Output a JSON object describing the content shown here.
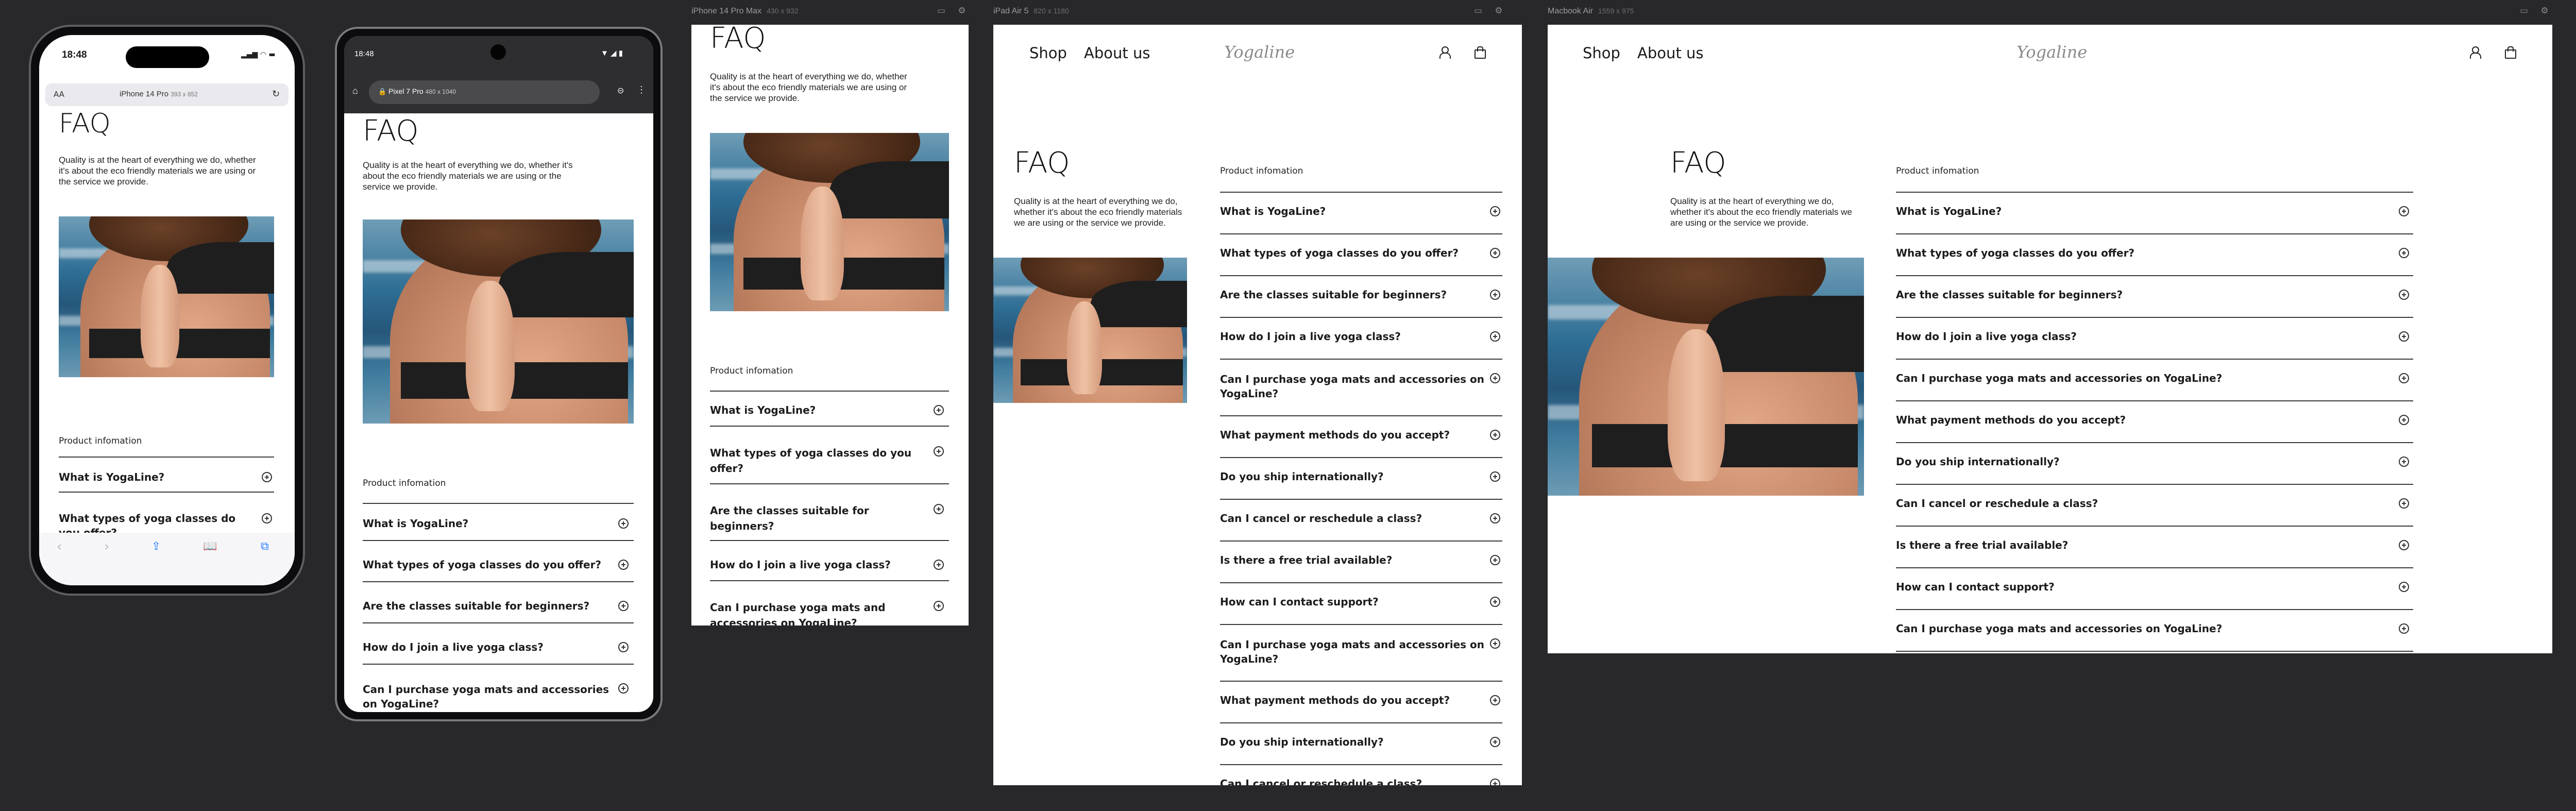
{
  "devices": {
    "iphone14pro": {
      "label": "iPhone 14 Pro",
      "dims": "393 x 852",
      "time": "18:48",
      "aa": "AA"
    },
    "pixel7": {
      "label": "Pixel 7 Pro",
      "dims": "480 x 1040",
      "time": "18:48"
    },
    "iphone14promax": {
      "label": "iPhone 14 Pro Max",
      "dims": "430 x 932"
    },
    "ipadair": {
      "label": "iPad Air 5",
      "dims": "820 x 1180"
    },
    "macbook": {
      "label": "Macbook Air",
      "dims": "1559 x 975"
    }
  },
  "page": {
    "title": "FAQ",
    "intro": "Quality is at the heart of everything we do, whether it's about the eco friendly materials we are using or the service we provide.",
    "section_heading": "Product infomation",
    "nav": {
      "shop": "Shop",
      "about": "About us",
      "logo": "Yogaline"
    }
  },
  "questions": {
    "q1": "What is YogaLine?",
    "q2": "What types of yoga classes do you offer?",
    "q3": "Are the classes suitable for beginners?",
    "q4": "How do I join a live yoga class?",
    "q5": "Can I purchase yoga mats and accessories on YogaLine?",
    "q6": "What payment methods do you accept?",
    "q7": "Do you ship internationally?",
    "q8": "Can I cancel or reschedule a class?",
    "q9": "Is there a free trial available?",
    "q10": "How can I contact support?"
  },
  "icons": [
    "search-icon",
    "refresh-icon",
    "share-icon",
    "book-icon",
    "tabs-icon",
    "plus-circle-icon",
    "user-icon",
    "bag-icon",
    "home-icon",
    "settings-icon"
  ],
  "colors": {
    "canvas": "#28282a",
    "page": "#ffffff",
    "text": "#1c1c1c",
    "rule": "#3a3a3a"
  }
}
